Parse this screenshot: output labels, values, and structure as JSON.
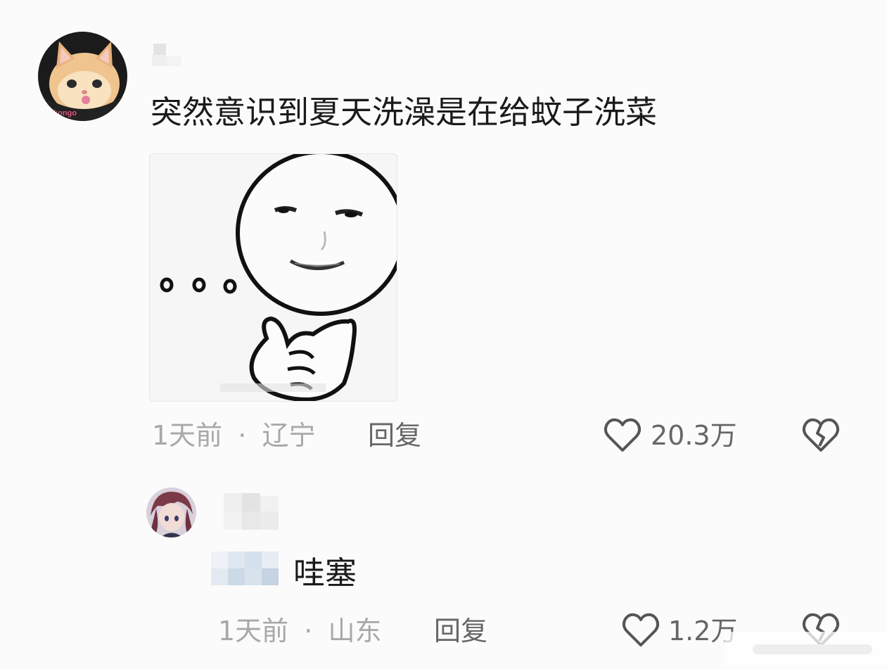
{
  "comments": [
    {
      "avatar_icon": "cat-avatar-icon",
      "text": "突然意识到夏天洗澡是在给蚊子洗菜",
      "sticker_icon": "thinking-face-sticker",
      "time": "1天前",
      "separator": "·",
      "location": "辽宁",
      "reply_label": "回复",
      "like_icon": "heart-outline-icon",
      "likes": "20.3万",
      "dislike_icon": "broken-heart-icon"
    }
  ],
  "replies": [
    {
      "avatar_icon": "anime-character-avatar-icon",
      "text": "哇塞",
      "time": "1天前",
      "separator": "·",
      "location": "山东",
      "reply_label": "回复",
      "like_icon": "heart-outline-icon",
      "likes": "1.2万",
      "dislike_icon": "broken-heart-icon"
    }
  ],
  "colors": {
    "background": "#fbfbfb",
    "text_primary": "#1a1a1a",
    "text_meta": "#a8a8a8",
    "text_action": "#666666"
  }
}
